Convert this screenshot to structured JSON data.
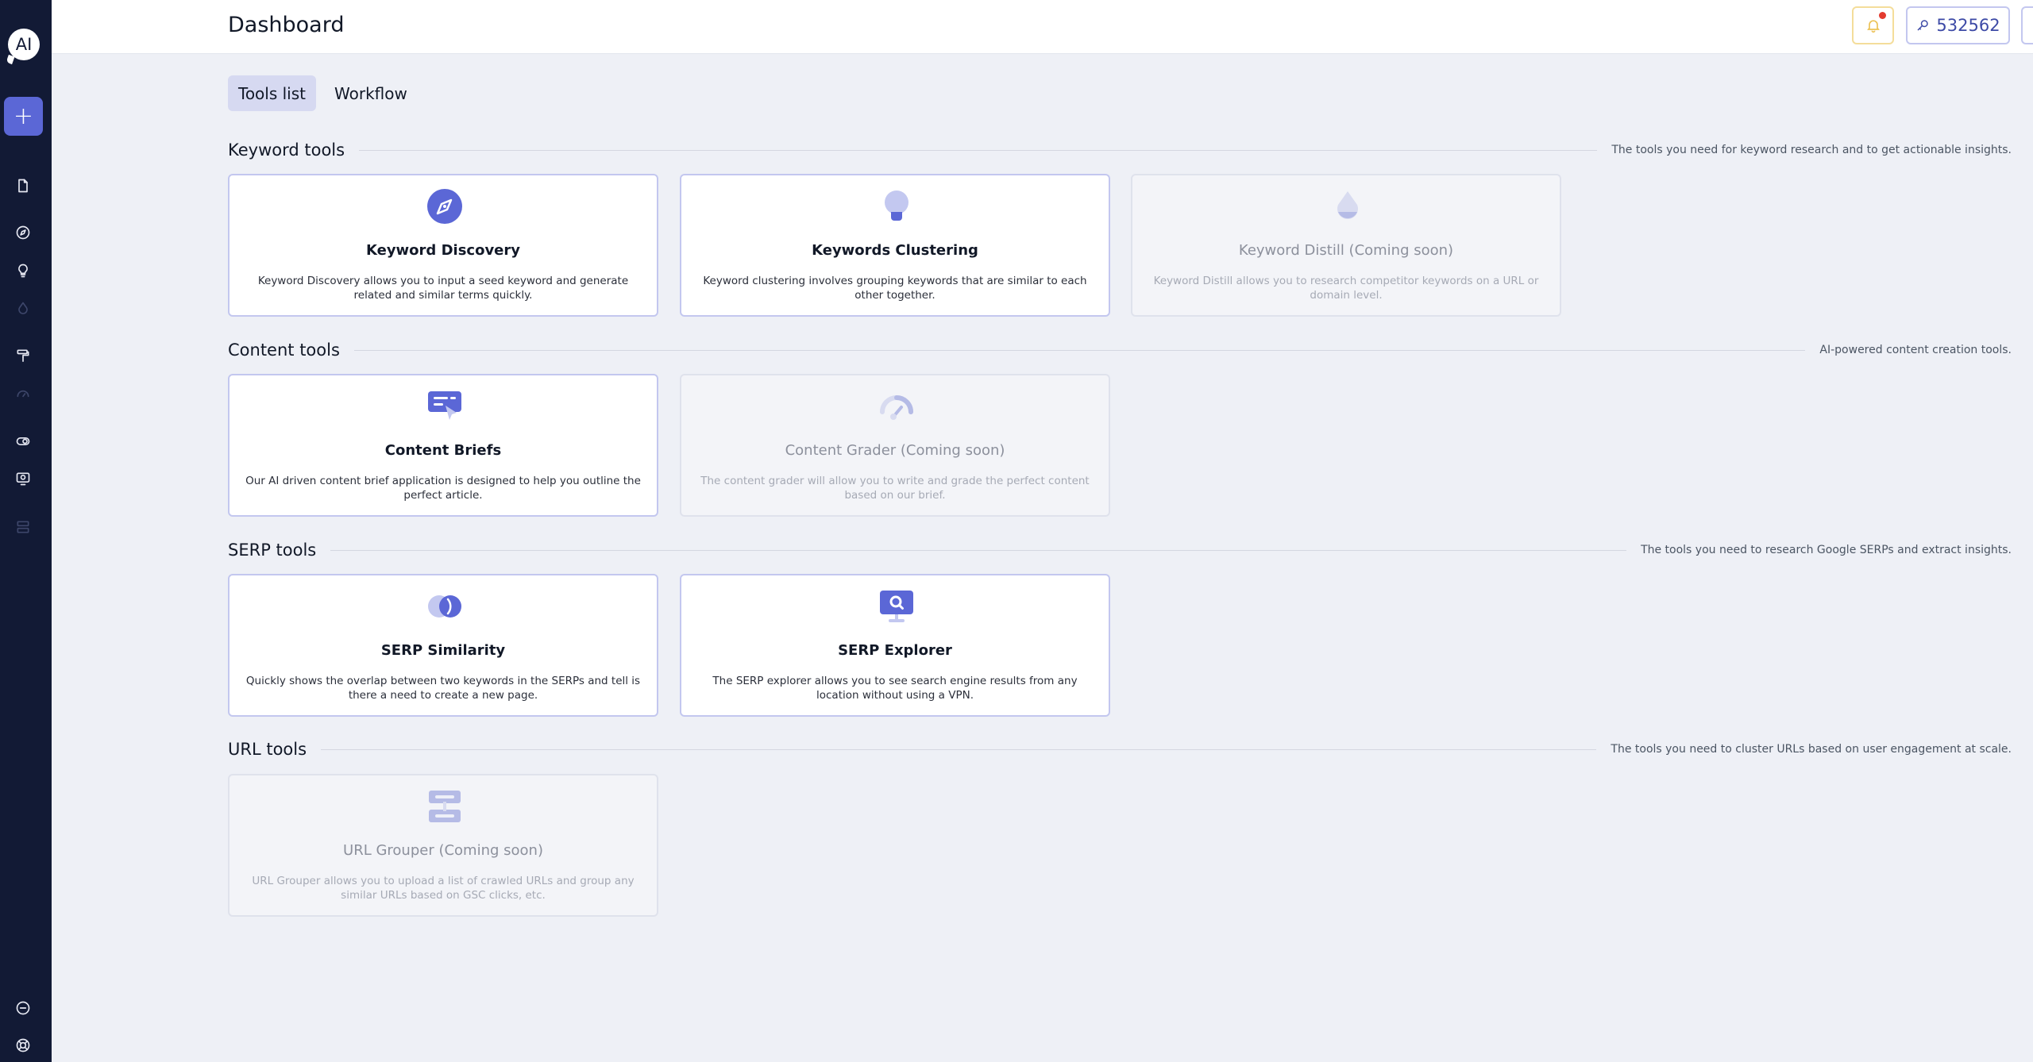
{
  "app": {
    "logo_text": "AI",
    "page_title": "Dashboard"
  },
  "header": {
    "credits": "532562",
    "notification_badge": true
  },
  "sidebar": {
    "add_label": "+",
    "items": [
      {
        "icon": "file-icon"
      },
      {
        "icon": "compass-icon"
      },
      {
        "icon": "lightbulb-icon"
      },
      {
        "icon": "drop-icon"
      },
      {
        "icon": "paint-roller-icon"
      },
      {
        "icon": "gauge-icon"
      },
      {
        "icon": "toggle-icon"
      },
      {
        "icon": "monitor-search-icon"
      },
      {
        "icon": "server-icon"
      },
      {
        "icon": "minus-circle-icon"
      },
      {
        "icon": "help-lifebuoy-icon"
      }
    ]
  },
  "tabs": [
    {
      "label": "Tools list",
      "active": true
    },
    {
      "label": "Workflow",
      "active": false
    }
  ],
  "sections": {
    "keyword": {
      "title": "Keyword tools",
      "desc": "The tools you need for keyword research and to get actionable insights.",
      "cards": [
        {
          "title": "Keyword Discovery",
          "desc": "Keyword Discovery allows you to input a seed keyword and generate related and similar terms quickly.",
          "icon": "compass-icon"
        },
        {
          "title": "Keywords Clustering",
          "desc": "Keyword clustering involves grouping keywords that are similar to each other together.",
          "icon": "lightbulb-icon"
        },
        {
          "title": "Keyword Distill (Coming soon)",
          "desc": "Keyword Distill allows you to research competitor keywords on a URL or domain level.",
          "icon": "drop-icon"
        }
      ]
    },
    "content": {
      "title": "Content tools",
      "desc": "AI-powered content creation tools.",
      "cards": [
        {
          "title": "Content Briefs",
          "desc": "Our AI driven content brief application is designed to help you outline the perfect article.",
          "icon": "brief-chat-icon"
        },
        {
          "title": "Content Grader (Coming soon)",
          "desc": "The content grader will allow you to write and grade the perfect content based on our brief.",
          "icon": "gauge-icon"
        }
      ]
    },
    "serp": {
      "title": "SERP tools",
      "desc": "The tools you need to research Google SERPs and extract insights.",
      "cards": [
        {
          "title": "SERP Similarity",
          "desc": "Quickly shows the overlap between two keywords in the SERPs and tell is there a need to create a new page.",
          "icon": "overlap-circles-icon"
        },
        {
          "title": "SERP Explorer",
          "desc": "The SERP explorer allows you to see search engine results from any location without using a VPN.",
          "icon": "monitor-search-icon"
        }
      ]
    },
    "url": {
      "title": "URL tools",
      "desc": "The tools you need to cluster URLs based on user engagement at scale.",
      "cards": [
        {
          "title": "URL Grouper (Coming soon)",
          "desc": "URL Grouper allows you to upload a list of crawled URLs and group any similar URLs based on GSC clicks, etc.",
          "icon": "server-icon"
        }
      ]
    }
  },
  "colors": {
    "sidebar_bg": "#121a35",
    "accent": "#5b67d6",
    "card_border": "#c3c7ef",
    "page_bg": "#eef0f6",
    "notification_dot": "#e33b2e"
  }
}
